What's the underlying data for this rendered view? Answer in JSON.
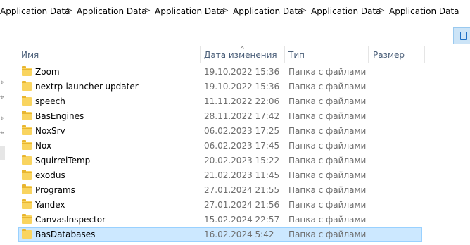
{
  "address_bar": {
    "crumbs": [
      "Application Data",
      "Application Data",
      "Application Data",
      "Application Data",
      "Application Data",
      "Application Data"
    ],
    "separator": ">"
  },
  "columns": {
    "name": "Имя",
    "date": "Дата изменения",
    "type": "Тип",
    "size": "Размер",
    "sort_indicator": "^"
  },
  "files": [
    {
      "name": "Zoom",
      "date": "19.10.2022 15:36",
      "type": "Папка с файлами",
      "selected": false
    },
    {
      "name": "nextrp-launcher-updater",
      "date": "19.10.2022 15:36",
      "type": "Папка с файлами",
      "selected": false
    },
    {
      "name": "speech",
      "date": "11.11.2022 22:06",
      "type": "Папка с файлами",
      "selected": false
    },
    {
      "name": "BasEngines",
      "date": "28.11.2022 17:42",
      "type": "Папка с файлами",
      "selected": false
    },
    {
      "name": "NoxSrv",
      "date": "06.02.2023 17:25",
      "type": "Папка с файлами",
      "selected": false
    },
    {
      "name": "Nox",
      "date": "06.02.2023 17:45",
      "type": "Папка с файлами",
      "selected": false
    },
    {
      "name": "SquirrelTemp",
      "date": "20.02.2023 15:22",
      "type": "Папка с файлами",
      "selected": false
    },
    {
      "name": "exodus",
      "date": "21.02.2023 11:45",
      "type": "Папка с файлами",
      "selected": false
    },
    {
      "name": "Programs",
      "date": "27.01.2024 21:55",
      "type": "Папка с файлами",
      "selected": false
    },
    {
      "name": "Yandex",
      "date": "27.01.2024 21:56",
      "type": "Папка с файлами",
      "selected": false
    },
    {
      "name": "CanvasInspector",
      "date": "15.02.2024 22:57",
      "type": "Папка с файлами",
      "selected": false
    },
    {
      "name": "BasDatabases",
      "date": "16.02.2024 5:42",
      "type": "Папка с файлами",
      "selected": true
    }
  ],
  "icons": {
    "folder": "folder-icon",
    "pin": "pin-icon",
    "view": "details-view-icon"
  },
  "colors": {
    "selection": "#cce8ff",
    "folder": "#f9d45f",
    "header_text": "#4c607a",
    "meta_text": "#6d6d6d"
  }
}
